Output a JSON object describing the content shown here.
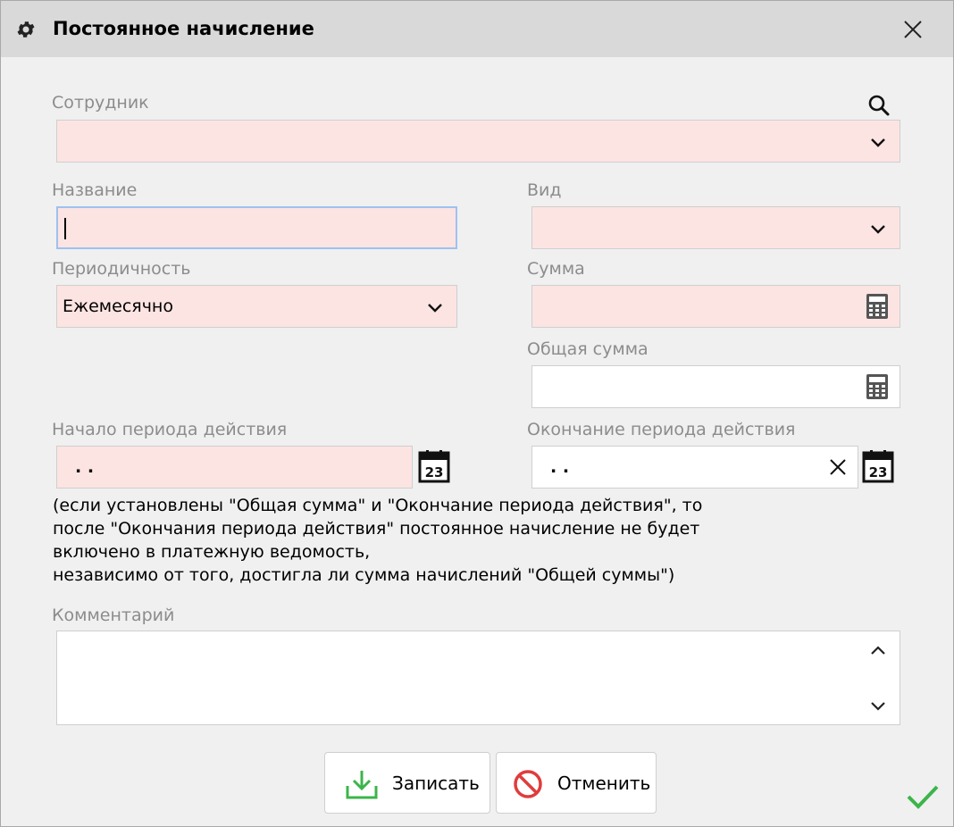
{
  "window": {
    "title": "Постоянное начисление"
  },
  "employee": {
    "label": "Сотрудник",
    "value": ""
  },
  "name": {
    "label": "Название",
    "value": ""
  },
  "kind": {
    "label": "Вид",
    "value": ""
  },
  "periodicity": {
    "label": "Периодичность",
    "value": "Ежемесячно"
  },
  "amount": {
    "label": "Сумма",
    "value": ""
  },
  "total_amount": {
    "label": "Общая сумма",
    "value": ""
  },
  "start_date": {
    "label": "Начало периода действия",
    "value": " .  ."
  },
  "end_date": {
    "label": "Окончание периода действия",
    "value": " .  ."
  },
  "note_lines": [
    "(если установлены \"Общая сумма\" и \"Окончание периода действия\", то",
    "после \"Окончания периода действия\" постоянное начисление не будет",
    "включено в платежную ведомость,",
    "независимо от того, достигла ли сумма начислений \"Общей суммы\")"
  ],
  "comment": {
    "label": "Комментарий",
    "value": ""
  },
  "buttons": {
    "save": "Записать",
    "cancel": "Отменить"
  },
  "date_icon_text": "23",
  "colors": {
    "required_field_bg": "#fce4e2",
    "title_bar_bg": "#d9d9d9",
    "save_icon": "#3cb44b",
    "cancel_icon": "#e03c3c",
    "ok_check": "#3cb44b",
    "label_gray": "#8c8c8c"
  },
  "icons": {
    "title": "gear-icon",
    "close": "close-icon",
    "search": "search-icon",
    "dropdown": "chevron-down-icon",
    "calculator": "calculator-icon",
    "calendar": "calendar-icon",
    "clear": "clear-icon",
    "save": "download-icon",
    "cancel": "prohibited-icon",
    "ok": "checkmark-icon"
  }
}
